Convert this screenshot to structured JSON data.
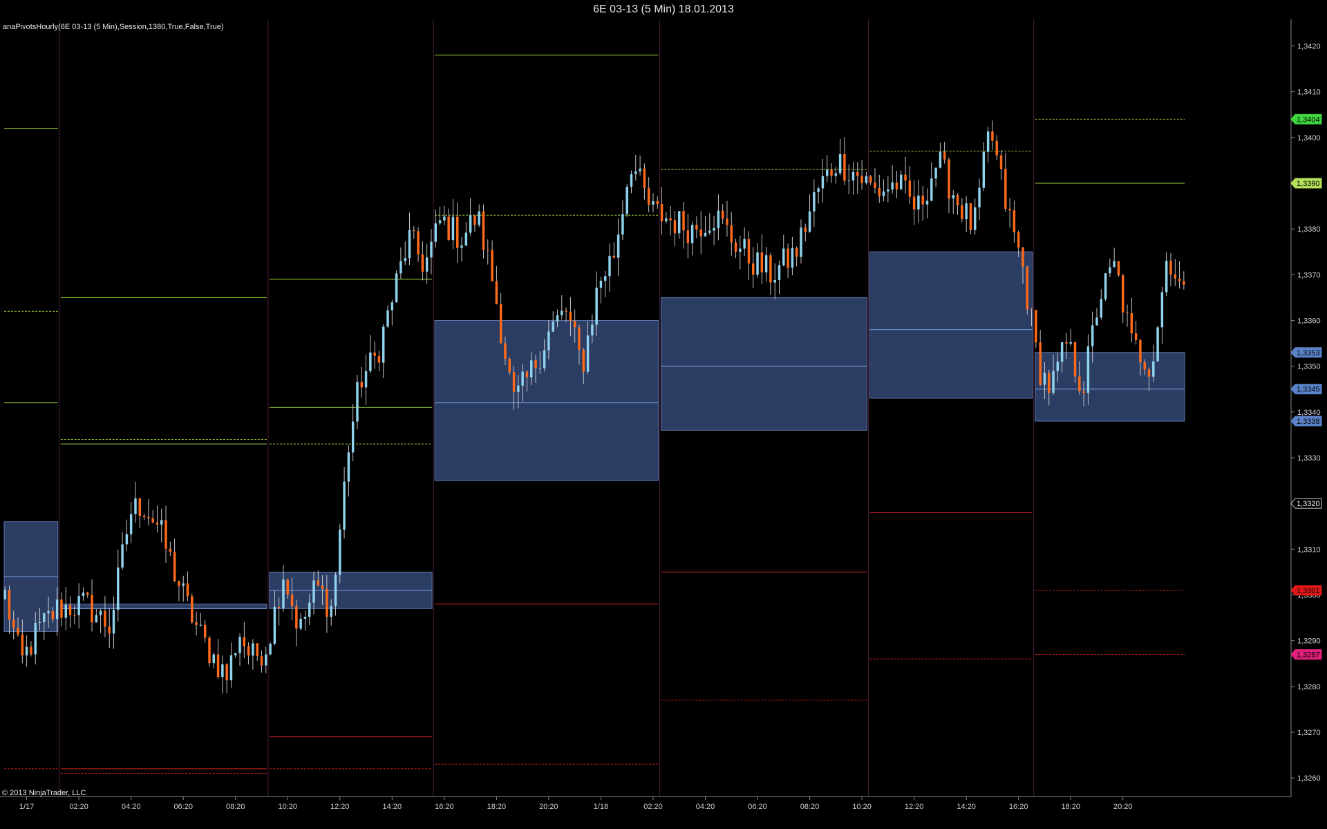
{
  "window": {
    "title": "6E 03-13 (5 Min)  18.01.2013",
    "indicator_label": "anaPivotsHourly(6E 03-13 (5 Min),Session,1380,True,False,True)",
    "copyright": "© 2013 NinjaTrader, LLC"
  },
  "chart_data": {
    "type": "candlestick",
    "instrument": "6E 03-13",
    "timeframe": "5 Min",
    "ylim": [
      1.3257,
      1.3424
    ],
    "y_ticks": [
      "1,3260",
      "1,3270",
      "1,3280",
      "1,3290",
      "1,3300",
      "1,3310",
      "1,3320",
      "1,3330",
      "1,3340",
      "1,3350",
      "1,3360",
      "1,3370",
      "1,3380",
      "1,3390",
      "1,3400",
      "1,3410",
      "1,3420"
    ],
    "y_tick_values": [
      1.326,
      1.327,
      1.328,
      1.329,
      1.33,
      1.331,
      1.332,
      1.333,
      1.334,
      1.335,
      1.336,
      1.337,
      1.338,
      1.339,
      1.34,
      1.341,
      1.342
    ],
    "x_ticks": [
      "1/17",
      "02:20",
      "04:20",
      "06:20",
      "08:20",
      "10:20",
      "12:20",
      "14:20",
      "16:20",
      "18:20",
      "20:20",
      "1/18",
      "02:20",
      "04:20",
      "06:20",
      "08:20",
      "10:20",
      "12:20",
      "14:20",
      "16:20",
      "18:20",
      "20:20"
    ],
    "x_tick_index": [
      5,
      17,
      29,
      41,
      53,
      65,
      77,
      89,
      101,
      113,
      125,
      137,
      149,
      161,
      173,
      185,
      197,
      209,
      221,
      233,
      245,
      257
    ],
    "bar_count": 272,
    "session_boundaries": [
      0,
      13,
      61,
      99,
      151,
      199,
      237,
      272
    ],
    "sessions": [
      {
        "cpr": [
          1.3292,
          1.3316
        ],
        "pivot": 1.3304,
        "lines": [
          {
            "v": 1.3402,
            "c": "#9ccf3f",
            "d": false
          },
          {
            "v": 1.3362,
            "c": "#9ccf3f",
            "d": true
          },
          {
            "v": 1.3342,
            "c": "#9ccf3f",
            "d": false
          },
          {
            "v": 1.3262,
            "c": "#cc2020",
            "d": true
          }
        ]
      },
      {
        "cpr": [
          1.3297,
          1.3298
        ],
        "pivot": 1.3297,
        "lines": [
          {
            "v": 1.3365,
            "c": "#9ccf3f",
            "d": false
          },
          {
            "v": 1.3334,
            "c": "#9ccf3f",
            "d": true
          },
          {
            "v": 1.3333,
            "c": "#9ccf3f",
            "d": false
          },
          {
            "v": 1.3262,
            "c": "#cc2020",
            "d": false
          },
          {
            "v": 1.3261,
            "c": "#cc2020",
            "d": true
          }
        ]
      },
      {
        "cpr": [
          1.3297,
          1.3305
        ],
        "pivot": 1.3301,
        "lines": [
          {
            "v": 1.3369,
            "c": "#9ccf3f",
            "d": false
          },
          {
            "v": 1.3341,
            "c": "#9ccf3f",
            "d": false
          },
          {
            "v": 1.3333,
            "c": "#9ccf3f",
            "d": true
          },
          {
            "v": 1.3269,
            "c": "#cc2020",
            "d": false
          },
          {
            "v": 1.3262,
            "c": "#cc2020",
            "d": true
          }
        ]
      },
      {
        "cpr": [
          1.3325,
          1.336
        ],
        "pivot": 1.3342,
        "lines": [
          {
            "v": 1.3418,
            "c": "#9ccf3f",
            "d": false
          },
          {
            "v": 1.3383,
            "c": "#9ccf3f",
            "d": true
          },
          {
            "v": 1.3298,
            "c": "#cc2020",
            "d": false
          },
          {
            "v": 1.3263,
            "c": "#cc2020",
            "d": true
          }
        ]
      },
      {
        "cpr": [
          1.3336,
          1.3365
        ],
        "pivot": 1.335,
        "lines": [
          {
            "v": 1.3393,
            "c": "#9ccf3f",
            "d": true
          },
          {
            "v": 1.3305,
            "c": "#cc2020",
            "d": false
          },
          {
            "v": 1.3277,
            "c": "#cc2020",
            "d": true
          }
        ]
      },
      {
        "cpr": [
          1.3343,
          1.3375
        ],
        "pivot": 1.3358,
        "lines": [
          {
            "v": 1.3397,
            "c": "#9ccf3f",
            "d": true
          },
          {
            "v": 1.3318,
            "c": "#cc2020",
            "d": false
          },
          {
            "v": 1.3286,
            "c": "#cc2020",
            "d": true
          }
        ]
      },
      {
        "cpr": [
          1.3338,
          1.3353
        ],
        "pivot": 1.3345,
        "lines": [
          {
            "v": 1.3404,
            "c": "#9ccf3f",
            "d": true
          },
          {
            "v": 1.339,
            "c": "#9ccf3f",
            "d": false
          },
          {
            "v": 1.3301,
            "c": "#cc2020",
            "d": true
          },
          {
            "v": 1.3287,
            "c": "#cc2020",
            "d": true
          }
        ]
      }
    ],
    "price_markers": [
      {
        "label": "1,3404",
        "value": 1.3404,
        "bg": "#3fd43f",
        "fg": "#000000"
      },
      {
        "label": "1,3390",
        "value": 1.339,
        "bg": "#b4e05a",
        "fg": "#000000"
      },
      {
        "label": "1,3353",
        "value": 1.3353,
        "bg": "#5a82c8",
        "fg": "#000000"
      },
      {
        "label": "1,3345",
        "value": 1.3345,
        "bg": "#5a82c8",
        "fg": "#000000"
      },
      {
        "label": "1,3338",
        "value": 1.3338,
        "bg": "#5a82c8",
        "fg": "#000000"
      },
      {
        "label": "1,3320",
        "value": 1.332,
        "bg": "#000000",
        "fg": "#ffffff"
      },
      {
        "label": "1,3301",
        "value": 1.3301,
        "bg": "#e01818",
        "fg": "#000000"
      },
      {
        "label": "1,3287",
        "value": 1.3287,
        "bg": "#e0207a",
        "fg": "#000000"
      }
    ],
    "waypoints": [
      [
        0,
        1.33
      ],
      [
        4,
        1.3285
      ],
      [
        8,
        1.3292
      ],
      [
        13,
        1.3297
      ],
      [
        20,
        1.3298
      ],
      [
        26,
        1.3293
      ],
      [
        31,
        1.3318
      ],
      [
        34,
        1.332
      ],
      [
        38,
        1.3315
      ],
      [
        42,
        1.3305
      ],
      [
        45,
        1.3298
      ],
      [
        49,
        1.329
      ],
      [
        55,
        1.3282
      ],
      [
        58,
        1.3292
      ],
      [
        61,
        1.3286
      ],
      [
        65,
        1.3289
      ],
      [
        69,
        1.3305
      ],
      [
        73,
        1.3292
      ],
      [
        77,
        1.3302
      ],
      [
        81,
        1.3297
      ],
      [
        85,
        1.3332
      ],
      [
        88,
        1.3347
      ],
      [
        92,
        1.3352
      ],
      [
        96,
        1.3365
      ],
      [
        100,
        1.3378
      ],
      [
        104,
        1.3372
      ],
      [
        108,
        1.3382
      ],
      [
        113,
        1.3378
      ],
      [
        117,
        1.3383
      ],
      [
        121,
        1.3368
      ],
      [
        126,
        1.3342
      ],
      [
        130,
        1.3348
      ],
      [
        135,
        1.3358
      ],
      [
        139,
        1.3362
      ],
      [
        143,
        1.335
      ],
      [
        147,
        1.3368
      ],
      [
        151,
        1.3375
      ],
      [
        155,
        1.3395
      ],
      [
        160,
        1.3384
      ],
      [
        165,
        1.3382
      ],
      [
        170,
        1.338
      ],
      [
        176,
        1.3383
      ],
      [
        180,
        1.3378
      ],
      [
        185,
        1.3373
      ],
      [
        190,
        1.337
      ],
      [
        196,
        1.3375
      ],
      [
        201,
        1.3388
      ],
      [
        206,
        1.3395
      ],
      [
        211,
        1.3392
      ],
      [
        216,
        1.3388
      ],
      [
        221,
        1.339
      ],
      [
        226,
        1.3384
      ],
      [
        231,
        1.3395
      ],
      [
        236,
        1.3386
      ],
      [
        240,
        1.338
      ],
      [
        244,
        1.3402
      ],
      [
        248,
        1.3385
      ],
      [
        252,
        1.3372
      ],
      [
        256,
        1.335
      ],
      [
        259,
        1.3345
      ],
      [
        263,
        1.3355
      ],
      [
        267,
        1.3345
      ],
      [
        271,
        1.3365
      ],
      [
        275,
        1.3372
      ],
      [
        279,
        1.3355
      ],
      [
        284,
        1.335
      ],
      [
        288,
        1.3375
      ],
      [
        292,
        1.3365
      ]
    ]
  }
}
